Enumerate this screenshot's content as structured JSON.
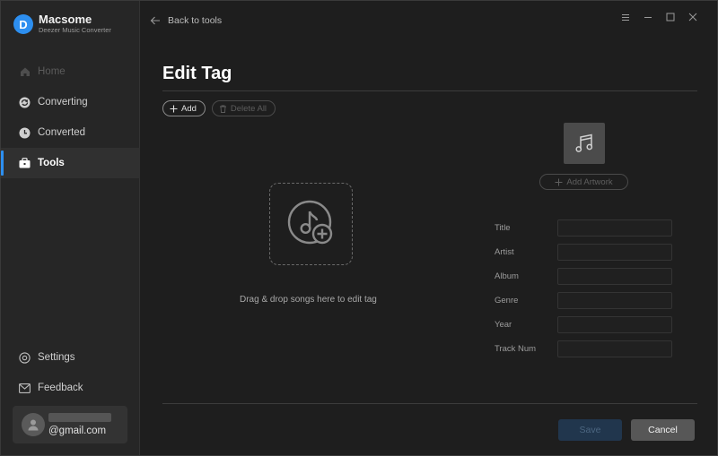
{
  "brand": {
    "name": "Macsome",
    "subtitle": "Deezer Music Converter",
    "logo_letter": "D",
    "logo_icon": "deezer-logo-icon"
  },
  "sidebar": {
    "items": [
      {
        "label": "Home",
        "icon": "home-icon",
        "state": "disabled"
      },
      {
        "label": "Converting",
        "icon": "converting-icon",
        "state": "normal"
      },
      {
        "label": "Converted",
        "icon": "clock-icon",
        "state": "normal"
      },
      {
        "label": "Tools",
        "icon": "toolbox-icon",
        "state": "active"
      }
    ],
    "bottom_items": [
      {
        "label": "Settings",
        "icon": "gear-icon"
      },
      {
        "label": "Feedback",
        "icon": "mail-icon"
      }
    ],
    "user": {
      "email": "@gmail.com",
      "avatar_icon": "user-avatar-icon"
    }
  },
  "topbar": {
    "back_label": "Back to tools",
    "controls": [
      "menu-icon",
      "minimize-icon",
      "maximize-icon",
      "close-icon"
    ]
  },
  "page": {
    "title": "Edit Tag",
    "add_label": "Add",
    "delete_all_label": "Delete All",
    "drop_text": "Drag & drop songs here to edit tag",
    "add_artwork_label": "Add Artwork"
  },
  "fields": [
    {
      "label": "Title",
      "value": ""
    },
    {
      "label": "Artist",
      "value": ""
    },
    {
      "label": "Album",
      "value": ""
    },
    {
      "label": "Genre",
      "value": ""
    },
    {
      "label": "Year",
      "value": ""
    },
    {
      "label": "Track Num",
      "value": ""
    }
  ],
  "footer": {
    "save_label": "Save",
    "cancel_label": "Cancel"
  },
  "colors": {
    "accent": "#2d8ff0",
    "background": "#1e1e1e",
    "sidebar": "#262626",
    "save_disabled": "#21364d",
    "cancel": "#575757"
  }
}
